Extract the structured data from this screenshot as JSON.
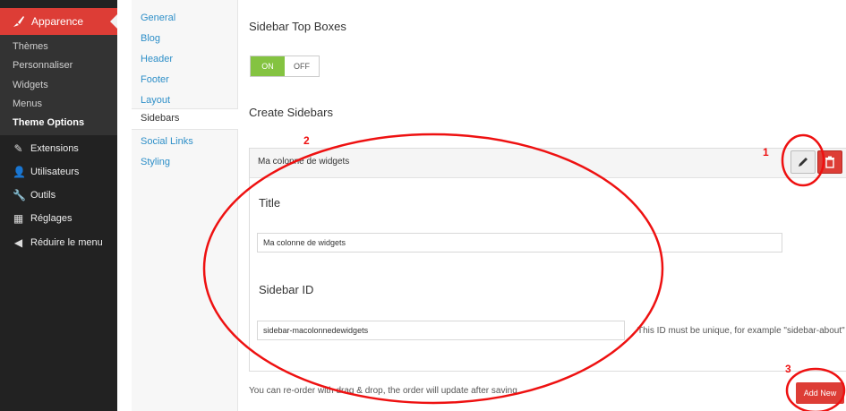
{
  "wp_menu": {
    "apparence": "Apparence",
    "submenu": [
      "Thèmes",
      "Personnaliser",
      "Widgets",
      "Menus",
      "Theme Options"
    ],
    "items": [
      {
        "label": "Extensions",
        "icon": "plugin-icon"
      },
      {
        "label": "Utilisateurs",
        "icon": "users-icon"
      },
      {
        "label": "Outils",
        "icon": "tools-icon"
      },
      {
        "label": "Réglages",
        "icon": "settings-icon"
      },
      {
        "label": "Réduire le menu",
        "icon": "collapse-icon"
      }
    ]
  },
  "tabs": [
    "General",
    "Blog",
    "Header",
    "Footer",
    "Layout",
    "Sidebars",
    "Social Links",
    "Styling"
  ],
  "main": {
    "top_boxes_heading": "Sidebar Top Boxes",
    "toggle_on": "ON",
    "toggle_off": "OFF",
    "create_heading": "Create Sidebars",
    "panel_name": "Ma colonne de widgets",
    "title_label": "Title",
    "title_value": "Ma colonne de widgets",
    "sidebar_id_label": "Sidebar ID",
    "sidebar_id_value": "sidebar-macolonnedewidgets",
    "help_text": "This ID must be unique, for example \"sidebar-about\"",
    "footer_note": "You can re-order with drag & drop, the order will update after saving.",
    "add_new": "Add New"
  },
  "annotations": {
    "mark1": "1",
    "mark2": "2",
    "mark3": "3"
  },
  "colors": {
    "wp_dark": "#222222",
    "wp_red": "#dd3d36",
    "link_blue": "#2e8fc8",
    "on_green": "#84c341",
    "annotation_red": "#e11111"
  }
}
